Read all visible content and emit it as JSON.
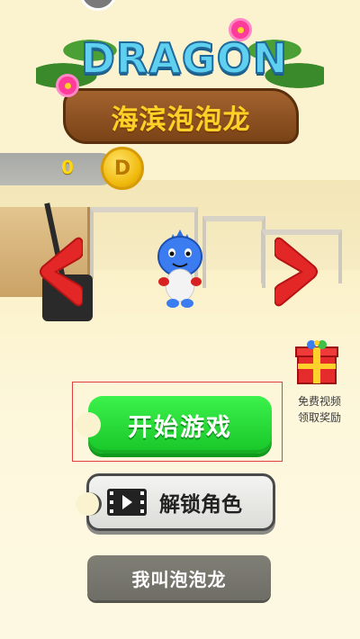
{
  "logo": {
    "title": "DRAGON",
    "subtitle": "海滨泡泡龙"
  },
  "coins": {
    "count": "0",
    "coin_symbol": "D"
  },
  "gift": {
    "icon": "gift-box-icon",
    "label_line1": "免费视频",
    "label_line2": "领取奖励"
  },
  "buttons": {
    "start": "开始游戏",
    "unlock": "解锁角色",
    "unlock_icon": "video-play-icon",
    "name": "我叫泡泡龙"
  },
  "colors": {
    "background": "#fbf3cf",
    "start_button": "#1ed32e",
    "coin": "#f0b90b",
    "name_button": "#77766e",
    "arrow_red": "#e32626",
    "highlight_box": "#e04040"
  }
}
